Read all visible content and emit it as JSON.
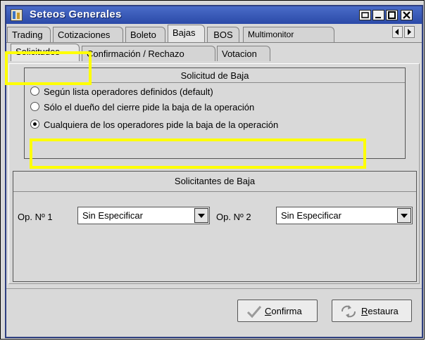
{
  "window": {
    "title": "Seteos Generales",
    "title_bar_color": "#2b4aa8",
    "controls": [
      "restore-icon",
      "minimize-icon",
      "maximize-icon",
      "close-icon"
    ]
  },
  "main_tabs": [
    {
      "label": "Trading",
      "active": false
    },
    {
      "label": "Cotizaciones",
      "active": false
    },
    {
      "label": "Boleto",
      "active": false
    },
    {
      "label": "Bajas",
      "active": true
    },
    {
      "label": "BOS",
      "active": false
    },
    {
      "label": "Multimonitor",
      "active": false
    }
  ],
  "sub_tabs": [
    {
      "label": "Solicitudes",
      "active": true
    },
    {
      "label": "Confirmación / Rechazo",
      "active": false
    },
    {
      "label": "Votacion",
      "active": false
    }
  ],
  "solicitud_group": {
    "title": "Solicitud de Baja",
    "options": [
      {
        "label": "Según lista operadores definidos (default)",
        "checked": false
      },
      {
        "label": "Sólo el dueño del cierre pide la baja de la operación",
        "checked": false
      },
      {
        "label": "Cualquiera de los operadores pide la baja de la operación",
        "checked": true
      }
    ]
  },
  "solicitantes_group": {
    "title": "Solicitantes de Baja",
    "op1_label": "Op. Nº 1",
    "op1_value": "Sin Especificar",
    "op2_label": "Op. Nº 2",
    "op2_value": "Sin Especificar"
  },
  "buttons": {
    "confirma": {
      "mnemonic": "C",
      "rest": "onfirma"
    },
    "restaura": {
      "mnemonic": "R",
      "rest": "estaura"
    }
  },
  "highlight_color": "#ffff00"
}
